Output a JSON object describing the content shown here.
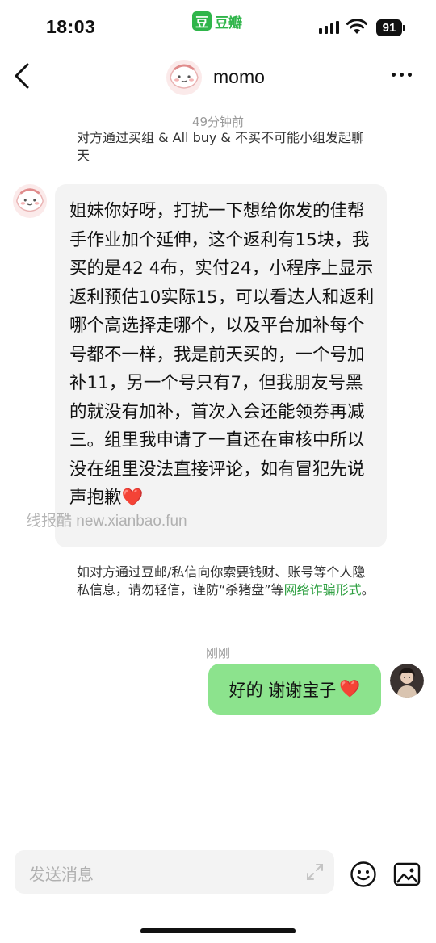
{
  "status_bar": {
    "time": "18:03",
    "battery": "91"
  },
  "brand": {
    "logo_char": "豆",
    "name": "豆瓣",
    "color": "#2fb54a"
  },
  "header": {
    "contact_name": "momo"
  },
  "messages": {
    "first_timestamp": "49分钟前",
    "system_notice": "对方通过买组 & All buy & 不买不可能小组发起聊天",
    "incoming_text": "姐妹你好呀，打扰一下想给你发的佳帮手作业加个延伸，这个返利有15块，我买的是42 4布，实付24，小程序上显示返利预估10实际15，可以看达人和返利哪个高选择走哪个，以及平台加补每个号都不一样，我是前天买的，一个号加补11，另一个号只有7，但我朋友号黑的就没有加补，首次入会还能领券再减三。组里我申请了一直还在审核中所以没在组里没法直接评论，如有冒犯先说声抱歉",
    "incoming_emoji": "❤️",
    "watermark": "线报酷 new.xianbao.fun",
    "warning_text": "如对方通过豆邮/私信向你索要钱财、账号等个人隐私信息，请勿轻信，谨防“杀猪盘”等",
    "warning_link": "网络诈骗形式",
    "warning_end": "。",
    "second_timestamp": "刚刚",
    "outgoing_text": "好的 谢谢宝子",
    "outgoing_emoji": "❤️",
    "outgoing_bubble_color": "#8ce38d"
  },
  "composer": {
    "placeholder": "发送消息"
  },
  "icons": [
    "back-icon",
    "more-icon",
    "expand-icon",
    "emoji-icon",
    "image-icon",
    "wifi-icon",
    "signal-icon"
  ]
}
